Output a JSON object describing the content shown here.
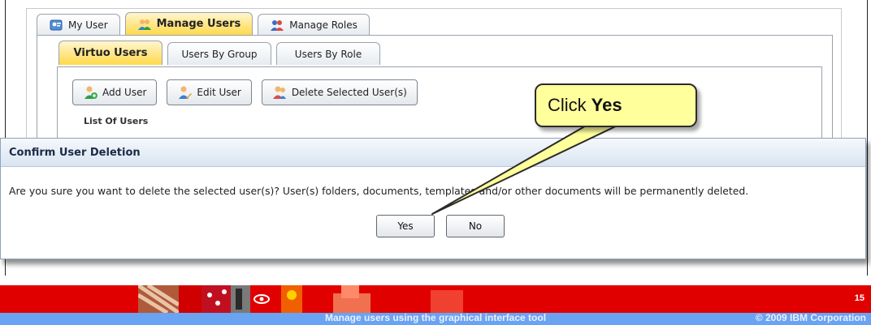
{
  "top_tabs": [
    {
      "label": "My User",
      "icon": "user-card-icon",
      "active": false
    },
    {
      "label": "Manage Users",
      "icon": "users-icon",
      "active": true
    },
    {
      "label": "Manage Roles",
      "icon": "roles-icon",
      "active": false
    }
  ],
  "sub_tabs": [
    {
      "label": "Virtuo Users",
      "active": true
    },
    {
      "label": "Users By Group",
      "active": false
    },
    {
      "label": "Users By Role",
      "active": false
    }
  ],
  "toolbar": {
    "add_user": "Add User",
    "edit_user": "Edit User",
    "delete_users": "Delete Selected User(s)"
  },
  "list_label": "List Of Users",
  "dialog": {
    "title": "Confirm User Deletion",
    "message": "Are you sure you want to delete the selected user(s)? User(s) folders, documents, templates and/or other documents will be permanently deleted.",
    "yes_label": "Yes",
    "no_label": "No"
  },
  "callout": {
    "prefix": "Click",
    "emphasis": "Yes"
  },
  "footer": {
    "title": "Manage users using the graphical interface tool",
    "copyright": "© 2009 IBM Corporation",
    "page_number": "15"
  },
  "colors": {
    "active_tab": "#ffd94a",
    "callout_fill": "#ffff9c",
    "footer_red": "#e00000",
    "footer_blue": "#6aa3f2"
  }
}
